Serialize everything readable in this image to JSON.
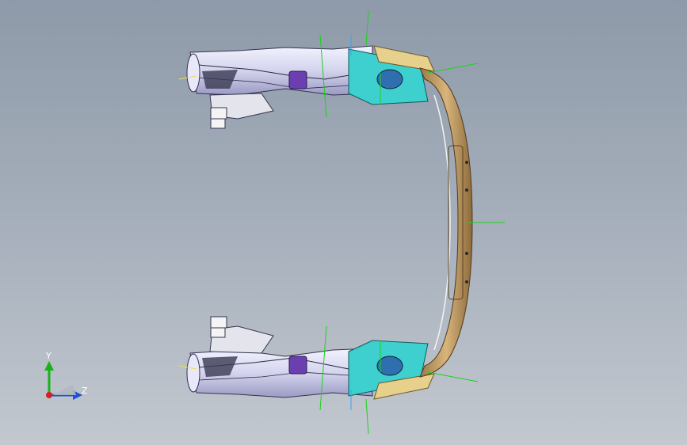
{
  "viewport": {
    "colors": {
      "bg_top": "#8e9aa9",
      "bg_bottom": "#c3c8cf",
      "rail_fill": "#dcdcf2",
      "rail_shadow": "#8f8fb6",
      "bracket_cyan": "#3ecfcf",
      "bumper_tan": "#c9a46a",
      "bumper_dark": "#8d6a3c",
      "purple_part": "#6b3fb0",
      "green_line": "#19d419",
      "blue_line": "#3aa0ff",
      "yellow_mark": "#e9e14a"
    }
  },
  "triad": {
    "y_label": "Y",
    "z_label": "Z",
    "y_color": "#19b219",
    "z_color": "#1f4fd8",
    "x_color": "#d81f1f"
  }
}
